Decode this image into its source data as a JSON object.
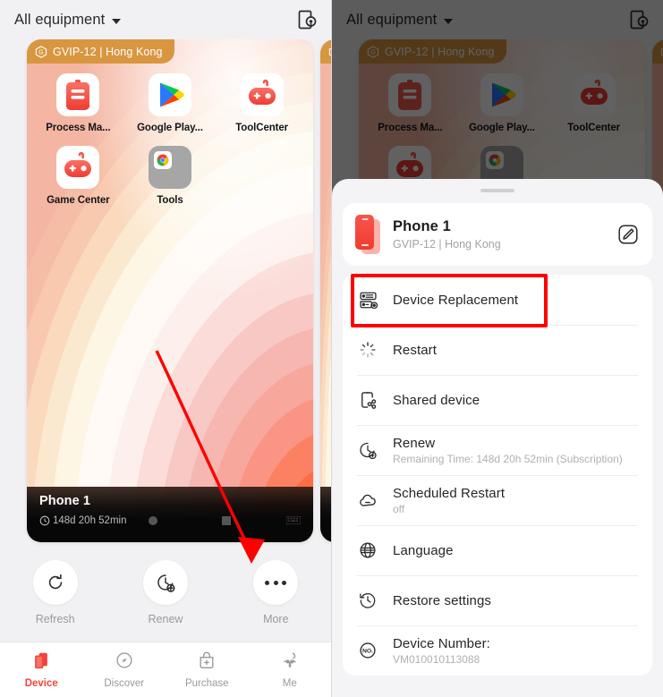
{
  "header": {
    "equipment_selector": "All equipment",
    "caret_icon": "chevron-down-icon",
    "right_icon": "device-monitor-icon"
  },
  "device_card": {
    "region_chip": "GVIP-12 | Hong Kong",
    "region_badge_icon": "g-hexagon-icon",
    "phone_name": "Phone 1",
    "remaining": "148d 20h 52min",
    "clock_icon": "clock-icon",
    "apps": [
      {
        "name": "Process Ma...",
        "icon": "process-manager-icon"
      },
      {
        "name": "Google Play...",
        "icon": "google-play-icon"
      },
      {
        "name": "ToolCenter",
        "icon": "toolcenter-gamepad-icon"
      },
      {
        "name": "Game Center",
        "icon": "game-center-gamepad-icon"
      },
      {
        "name": "Tools",
        "icon": "tools-folder-chrome-icon"
      }
    ],
    "nav_icons": [
      "nav-circle-icon",
      "nav-square-icon",
      "nav-keyboard-icon"
    ]
  },
  "actions": [
    {
      "label": "Refresh",
      "icon": "refresh-icon"
    },
    {
      "label": "Renew",
      "icon": "clock-plus-icon"
    },
    {
      "label": "More",
      "icon": "ellipsis-icon"
    }
  ],
  "tabs": [
    {
      "label": "Device",
      "icon": "device-stack-icon",
      "active": true
    },
    {
      "label": "Discover",
      "icon": "compass-icon",
      "active": false
    },
    {
      "label": "Purchase",
      "icon": "shopping-bag-icon",
      "active": false
    },
    {
      "label": "Me",
      "icon": "person-icon",
      "active": false
    }
  ],
  "sheet": {
    "grabber": "drag-handle",
    "device": {
      "name": "Phone 1",
      "subtitle": "GVIP-12 | Hong Kong",
      "thumb_icon": "phone-thumbnail-icon",
      "edit_icon": "edit-pencil-icon"
    },
    "menu": [
      {
        "title": "Device Replacement",
        "sub": "",
        "icon": "server-replace-icon"
      },
      {
        "title": "Restart",
        "sub": "",
        "icon": "spinner-restart-icon"
      },
      {
        "title": "Shared device",
        "sub": "",
        "icon": "share-device-icon"
      },
      {
        "title": "Renew",
        "sub": "Remaining Time: 148d 20h 52min (Subscription)",
        "icon": "clock-plus-icon"
      },
      {
        "title": "Scheduled Restart",
        "sub": "off",
        "icon": "cloud-minus-icon"
      },
      {
        "title": "Language",
        "sub": "",
        "icon": "globe-icon"
      },
      {
        "title": "Restore settings",
        "sub": "",
        "icon": "history-restore-icon"
      },
      {
        "title": "Device Number:",
        "sub": "VM010010113088",
        "icon": "no-circle-icon"
      }
    ]
  },
  "annotations": {
    "highlight_color": "#ff0000",
    "arrow_color": "#ff0000",
    "highlight_target": "Device Replacement",
    "arrow_target": "More"
  },
  "colors": {
    "accent_red": "#f5433a",
    "chip_orange": "#d99640",
    "panel_bg": "#f1f1f3",
    "sheet_bg": "#f4f4f6"
  }
}
